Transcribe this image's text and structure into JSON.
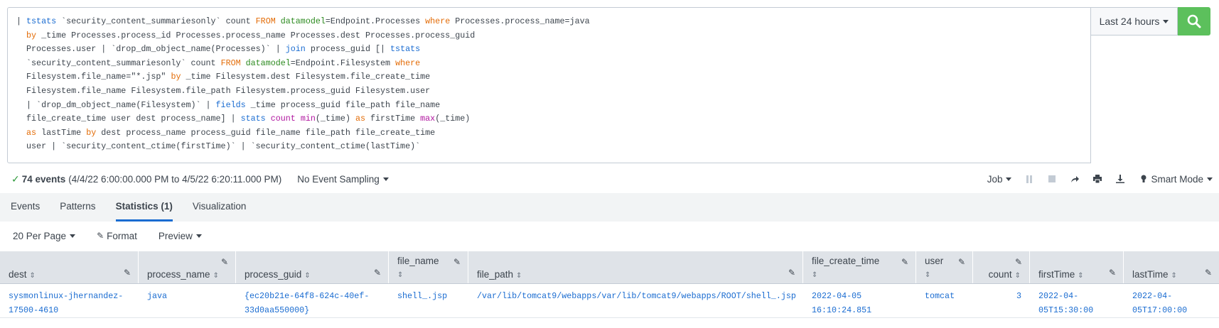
{
  "search": {
    "query_lines": [
      [
        {
          "t": "| ",
          "c": ""
        },
        {
          "t": "tstats",
          "c": "kw-blue"
        },
        {
          "t": " `security_content_summariesonly` count ",
          "c": ""
        },
        {
          "t": "FROM",
          "c": "kw-orange"
        },
        {
          "t": " ",
          "c": ""
        },
        {
          "t": "datamodel",
          "c": "kw-green"
        },
        {
          "t": "=Endpoint.Processes ",
          "c": ""
        },
        {
          "t": "where",
          "c": "kw-orange"
        },
        {
          "t": " Processes.process_name=java",
          "c": ""
        }
      ],
      [
        {
          "t": "  ",
          "c": ""
        },
        {
          "t": "by",
          "c": "kw-orange"
        },
        {
          "t": " _time Processes.process_id Processes.process_name Processes.dest Processes.process_guid",
          "c": ""
        }
      ],
      [
        {
          "t": "  Processes.user | `drop_dm_object_name(Processes)` | ",
          "c": ""
        },
        {
          "t": "join",
          "c": "kw-blue"
        },
        {
          "t": " process_guid [| ",
          "c": ""
        },
        {
          "t": "tstats",
          "c": "kw-blue"
        }
      ],
      [
        {
          "t": "  `security_content_summariesonly` count ",
          "c": ""
        },
        {
          "t": "FROM",
          "c": "kw-orange"
        },
        {
          "t": " ",
          "c": ""
        },
        {
          "t": "datamodel",
          "c": "kw-green"
        },
        {
          "t": "=Endpoint.Filesystem ",
          "c": ""
        },
        {
          "t": "where",
          "c": "kw-orange"
        }
      ],
      [
        {
          "t": "  Filesystem.file_name=\"*.jsp\" ",
          "c": ""
        },
        {
          "t": "by",
          "c": "kw-orange"
        },
        {
          "t": " _time Filesystem.dest Filesystem.file_create_time",
          "c": ""
        }
      ],
      [
        {
          "t": "  Filesystem.file_name Filesystem.file_path Filesystem.process_guid Filesystem.user",
          "c": ""
        }
      ],
      [
        {
          "t": "  | `drop_dm_object_name(Filesystem)` | ",
          "c": ""
        },
        {
          "t": "fields",
          "c": "kw-blue"
        },
        {
          "t": " _time process_guid file_path file_name",
          "c": ""
        }
      ],
      [
        {
          "t": "  file_create_time user dest process_name] | ",
          "c": ""
        },
        {
          "t": "stats",
          "c": "kw-blue"
        },
        {
          "t": " ",
          "c": ""
        },
        {
          "t": "count",
          "c": "kw-magenta"
        },
        {
          "t": " ",
          "c": ""
        },
        {
          "t": "min",
          "c": "kw-magenta"
        },
        {
          "t": "(_time) ",
          "c": ""
        },
        {
          "t": "as",
          "c": "kw-orange"
        },
        {
          "t": " firstTime ",
          "c": ""
        },
        {
          "t": "max",
          "c": "kw-magenta"
        },
        {
          "t": "(_time)",
          "c": ""
        }
      ],
      [
        {
          "t": "  ",
          "c": ""
        },
        {
          "t": "as",
          "c": "kw-orange"
        },
        {
          "t": " lastTime ",
          "c": ""
        },
        {
          "t": "by",
          "c": "kw-orange"
        },
        {
          "t": " dest process_name process_guid file_name file_path file_create_time",
          "c": ""
        }
      ],
      [
        {
          "t": "  user | `security_content_ctime(firstTime)` | `security_content_ctime(lastTime)`",
          "c": ""
        }
      ]
    ],
    "time_range": "Last 24 hours",
    "search_icon": "search-icon",
    "button_color": "#5cc05c"
  },
  "status": {
    "events": "74 events",
    "range": "(4/4/22 6:00:00.000 PM to 4/5/22 6:20:11.000 PM)",
    "sampling": "No Event Sampling",
    "job": "Job",
    "mode": "Smart Mode"
  },
  "tabs": [
    {
      "label": "Events"
    },
    {
      "label": "Patterns"
    },
    {
      "label": "Statistics (1)"
    },
    {
      "label": "Visualization"
    }
  ],
  "toolbar": {
    "per_page": "20 Per Page",
    "format": "Format",
    "preview": "Preview"
  },
  "table": {
    "columns": [
      "dest",
      "process_name",
      "process_guid",
      "file_name",
      "file_path",
      "file_create_time",
      "user",
      "count",
      "firstTime",
      "lastTime"
    ],
    "row": {
      "dest": "sysmonlinux-jhernandez-\n17500-4610",
      "process_name": "java",
      "process_guid": "{ec20b21e-64f8-624c-40ef-\n33d0aa550000}",
      "file_name": "shell_.jsp",
      "file_path": "/var/lib/tomcat9/webapps/var/lib/tomcat9/webapps/ROOT/shell_.jsp",
      "file_create_time": "2022-04-05\n16:10:24.851",
      "user": "tomcat",
      "count": "3",
      "firstTime": "2022-04-\n05T15:30:00",
      "lastTime": "2022-04-\n05T17:00:00"
    }
  }
}
